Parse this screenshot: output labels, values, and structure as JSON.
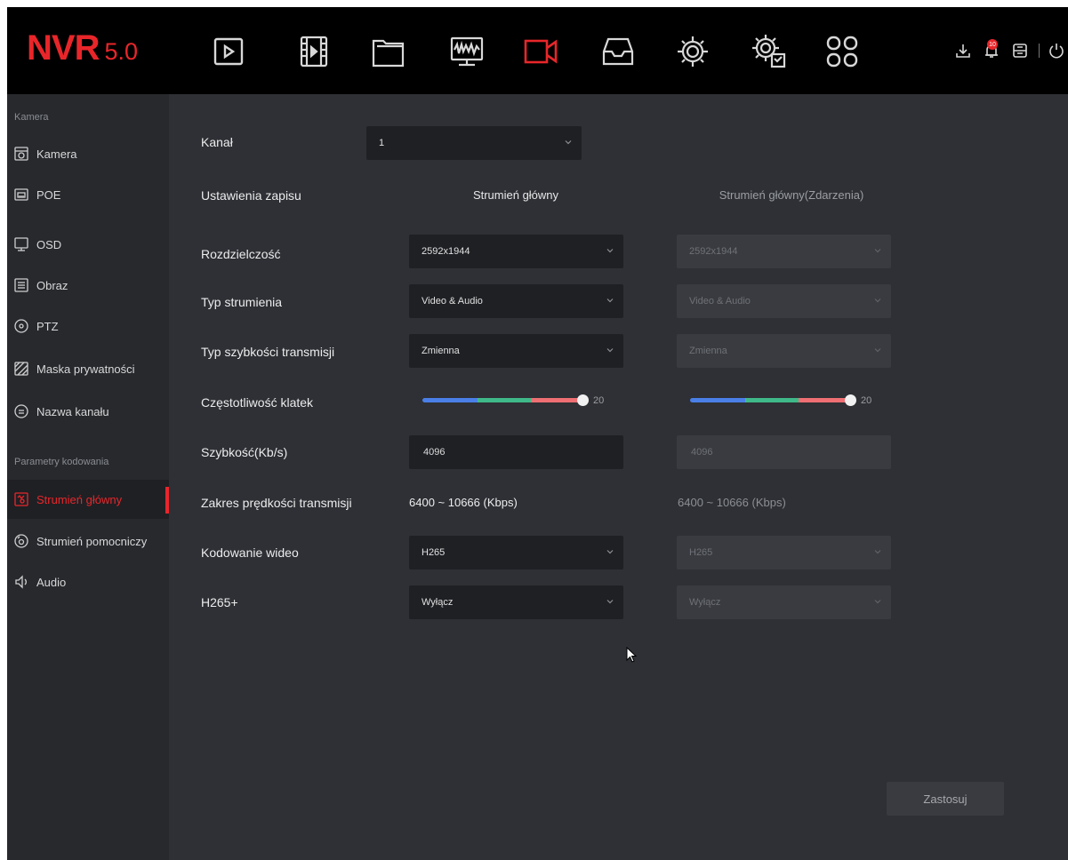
{
  "app": {
    "brand": "NVR",
    "version": "5.0"
  },
  "topnav": {
    "icons": [
      "live-view-icon",
      "playback-icon",
      "file-manager-icon",
      "system-monitor-icon",
      "camera-config-icon",
      "storage-icon",
      "settings-icon",
      "advanced-settings-icon",
      "apps-icon"
    ],
    "active": "camera-config-icon",
    "notification_count": "10"
  },
  "sidebar": {
    "section_camera": "Kamera",
    "items_camera": [
      {
        "label": "Kamera",
        "icon": "dome-camera-icon"
      },
      {
        "label": "POE",
        "icon": "poe-icon"
      },
      {
        "label": "OSD",
        "icon": "monitor-icon"
      },
      {
        "label": "Obraz",
        "icon": "image-adjust-icon"
      },
      {
        "label": "PTZ",
        "icon": "ptz-icon"
      },
      {
        "label": "Maska prywatności",
        "icon": "privacy-mask-icon"
      },
      {
        "label": "Nazwa kanału",
        "icon": "channel-name-icon"
      }
    ],
    "section_encoding": "Parametry kodowania",
    "items_encoding": [
      {
        "label": "Strumień główny",
        "icon": "main-stream-icon",
        "active": true
      },
      {
        "label": "Strumień pomocniczy",
        "icon": "sub-stream-icon"
      },
      {
        "label": "Audio",
        "icon": "speaker-icon"
      }
    ]
  },
  "form": {
    "channel_label": "Kanał",
    "channel_value": "1",
    "record_settings_label": "Ustawienia zapisu",
    "col_main": "Strumień główny",
    "col_event": "Strumień główny(Zdarzenia)",
    "resolution_label": "Rozdzielczość",
    "resolution_main": "2592x1944",
    "resolution_event": "2592x1944",
    "stream_type_label": "Typ strumienia",
    "stream_type_main": "Video & Audio",
    "stream_type_event": "Video & Audio",
    "bitrate_type_label": "Typ szybkości transmisji",
    "bitrate_type_main": "Zmienna",
    "bitrate_type_event": "Zmienna",
    "framerate_label": "Częstotliwość klatek",
    "framerate_main": "20",
    "framerate_event": "20",
    "framerate_fraction": 1.0,
    "bitrate_label": "Szybkość(Kb/s)",
    "bitrate_main": "4096",
    "bitrate_event": "4096",
    "bitrate_range_label": "Zakres prędkości transmisji",
    "bitrate_range_main": "6400 ~ 10666 (Kbps)",
    "bitrate_range_event": "6400 ~ 10666 (Kbps)",
    "video_codec_label": "Kodowanie wideo",
    "video_codec_main": "H265",
    "video_codec_event": "H265",
    "h265plus_label": "H265+",
    "h265plus_main": "Wyłącz",
    "h265plus_event": "Wyłącz",
    "apply_label": "Zastosuj"
  },
  "colors": {
    "accent": "#e8262a",
    "slider_blue": "#4a7fe8",
    "slider_green": "#3fb98a",
    "slider_red": "#ef6f73"
  }
}
